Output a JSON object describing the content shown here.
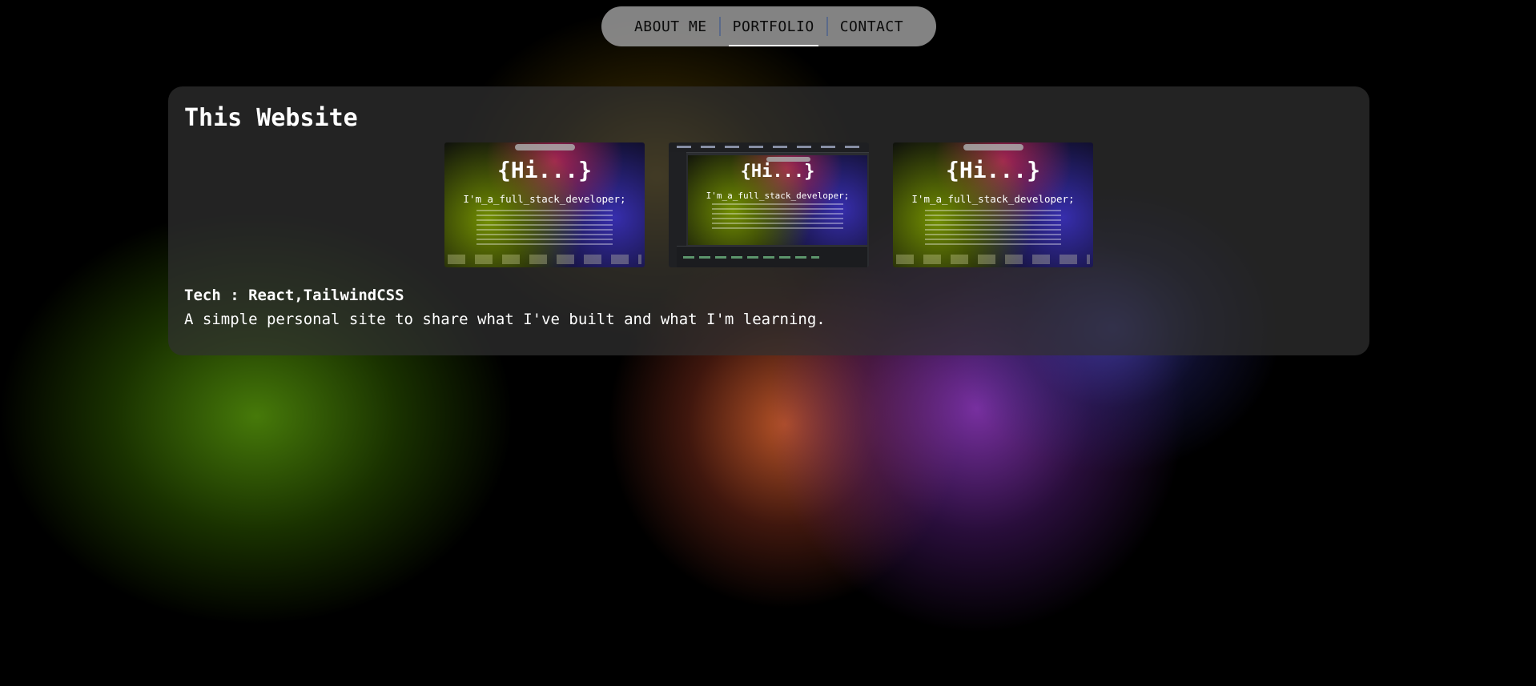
{
  "nav": {
    "items": [
      {
        "label": "ABOUT ME",
        "active": false
      },
      {
        "label": "PORTFOLIO",
        "active": true
      },
      {
        "label": "CONTACT",
        "active": false
      }
    ]
  },
  "project": {
    "title": "This Website",
    "screenshots": [
      {
        "heading": "{Hi...}",
        "subheading": "I'm_a_full_stack_developer;"
      },
      {
        "heading": "{Hi...}",
        "subheading": "I'm_a_full_stack_developer;"
      },
      {
        "heading": "{Hi...}",
        "subheading": "I'm_a_full_stack_developer;"
      }
    ],
    "tech": "Tech : React,TailwindCSS",
    "description": "A simple personal site to share what I've built and what I'm learning."
  },
  "colors": {
    "background": "#000000",
    "nav_bg": "#a0a0a0",
    "card_bg": "#303030",
    "active_underline": "#ffffff",
    "blob_green": "#4a800a",
    "blob_orange": "#d25f2d",
    "blob_purple": "#963cc8",
    "blob_blue": "#4646be"
  }
}
